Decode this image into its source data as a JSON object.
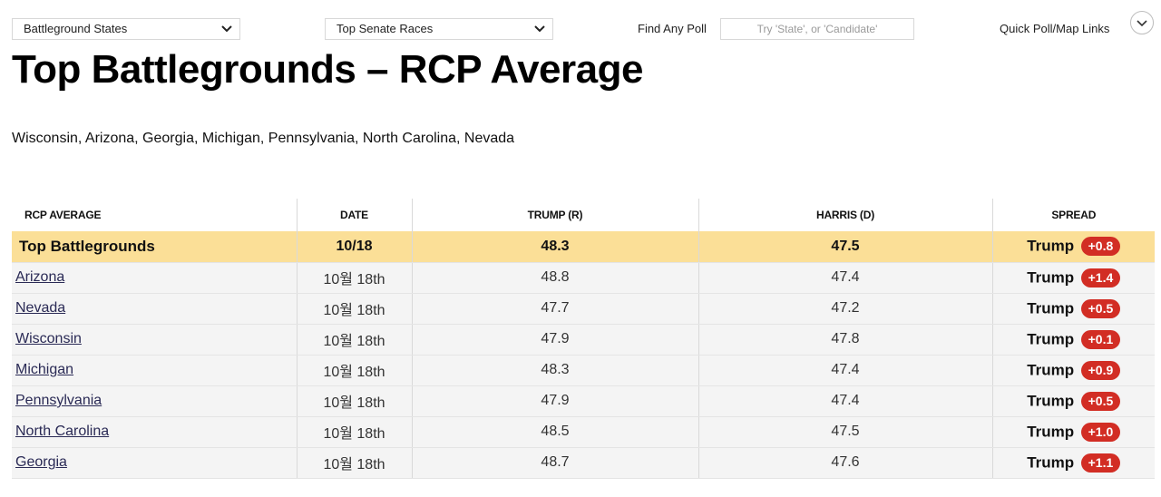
{
  "nav": {
    "battleground_select": "Battleground States",
    "senate_select": "Top Senate Races",
    "find_label": "Find Any Poll",
    "find_placeholder": "Try 'State', or 'Candidate'",
    "quick_label": "Quick Poll/Map Links",
    "icons": {
      "select_arrow": "chevron-down-icon",
      "quick_toggle": "chevron-down-icon"
    }
  },
  "page": {
    "title": "Top Battlegrounds – RCP Average",
    "subtitle": "Wisconsin, Arizona, Georgia, Michigan, Pennsylvania, North Carolina, Nevada"
  },
  "table": {
    "headers": [
      "RCP AVERAGE",
      "DATE",
      "TRUMP (R)",
      "HARRIS (D)",
      "SPREAD"
    ],
    "average": {
      "name": "Top Battlegrounds",
      "date": "10/18",
      "trump": "48.3",
      "harris": "47.5",
      "spread_leader": "Trump",
      "spread_value": "+0.8"
    },
    "rows": [
      {
        "state": "Arizona",
        "date": "10월 18th",
        "trump": "48.8",
        "harris": "47.4",
        "spread_leader": "Trump",
        "spread_value": "+1.4"
      },
      {
        "state": "Nevada",
        "date": "10월 18th",
        "trump": "47.7",
        "harris": "47.2",
        "spread_leader": "Trump",
        "spread_value": "+0.5"
      },
      {
        "state": "Wisconsin",
        "date": "10월 18th",
        "trump": "47.9",
        "harris": "47.8",
        "spread_leader": "Trump",
        "spread_value": "+0.1"
      },
      {
        "state": "Michigan",
        "date": "10월 18th",
        "trump": "48.3",
        "harris": "47.4",
        "spread_leader": "Trump",
        "spread_value": "+0.9"
      },
      {
        "state": "Pennsylvania",
        "date": "10월 18th",
        "trump": "47.9",
        "harris": "47.4",
        "spread_leader": "Trump",
        "spread_value": "+0.5"
      },
      {
        "state": "North Carolina",
        "date": "10월 18th",
        "trump": "48.5",
        "harris": "47.5",
        "spread_leader": "Trump",
        "spread_value": "+1.0"
      },
      {
        "state": "Georgia",
        "date": "10월 18th",
        "trump": "48.7",
        "harris": "47.6",
        "spread_leader": "Trump",
        "spread_value": "+1.1"
      }
    ]
  },
  "colors": {
    "average_row_bg": "#fbdf97",
    "spread_badge": "#d22d24",
    "row_bg": "#f4f4f4"
  }
}
